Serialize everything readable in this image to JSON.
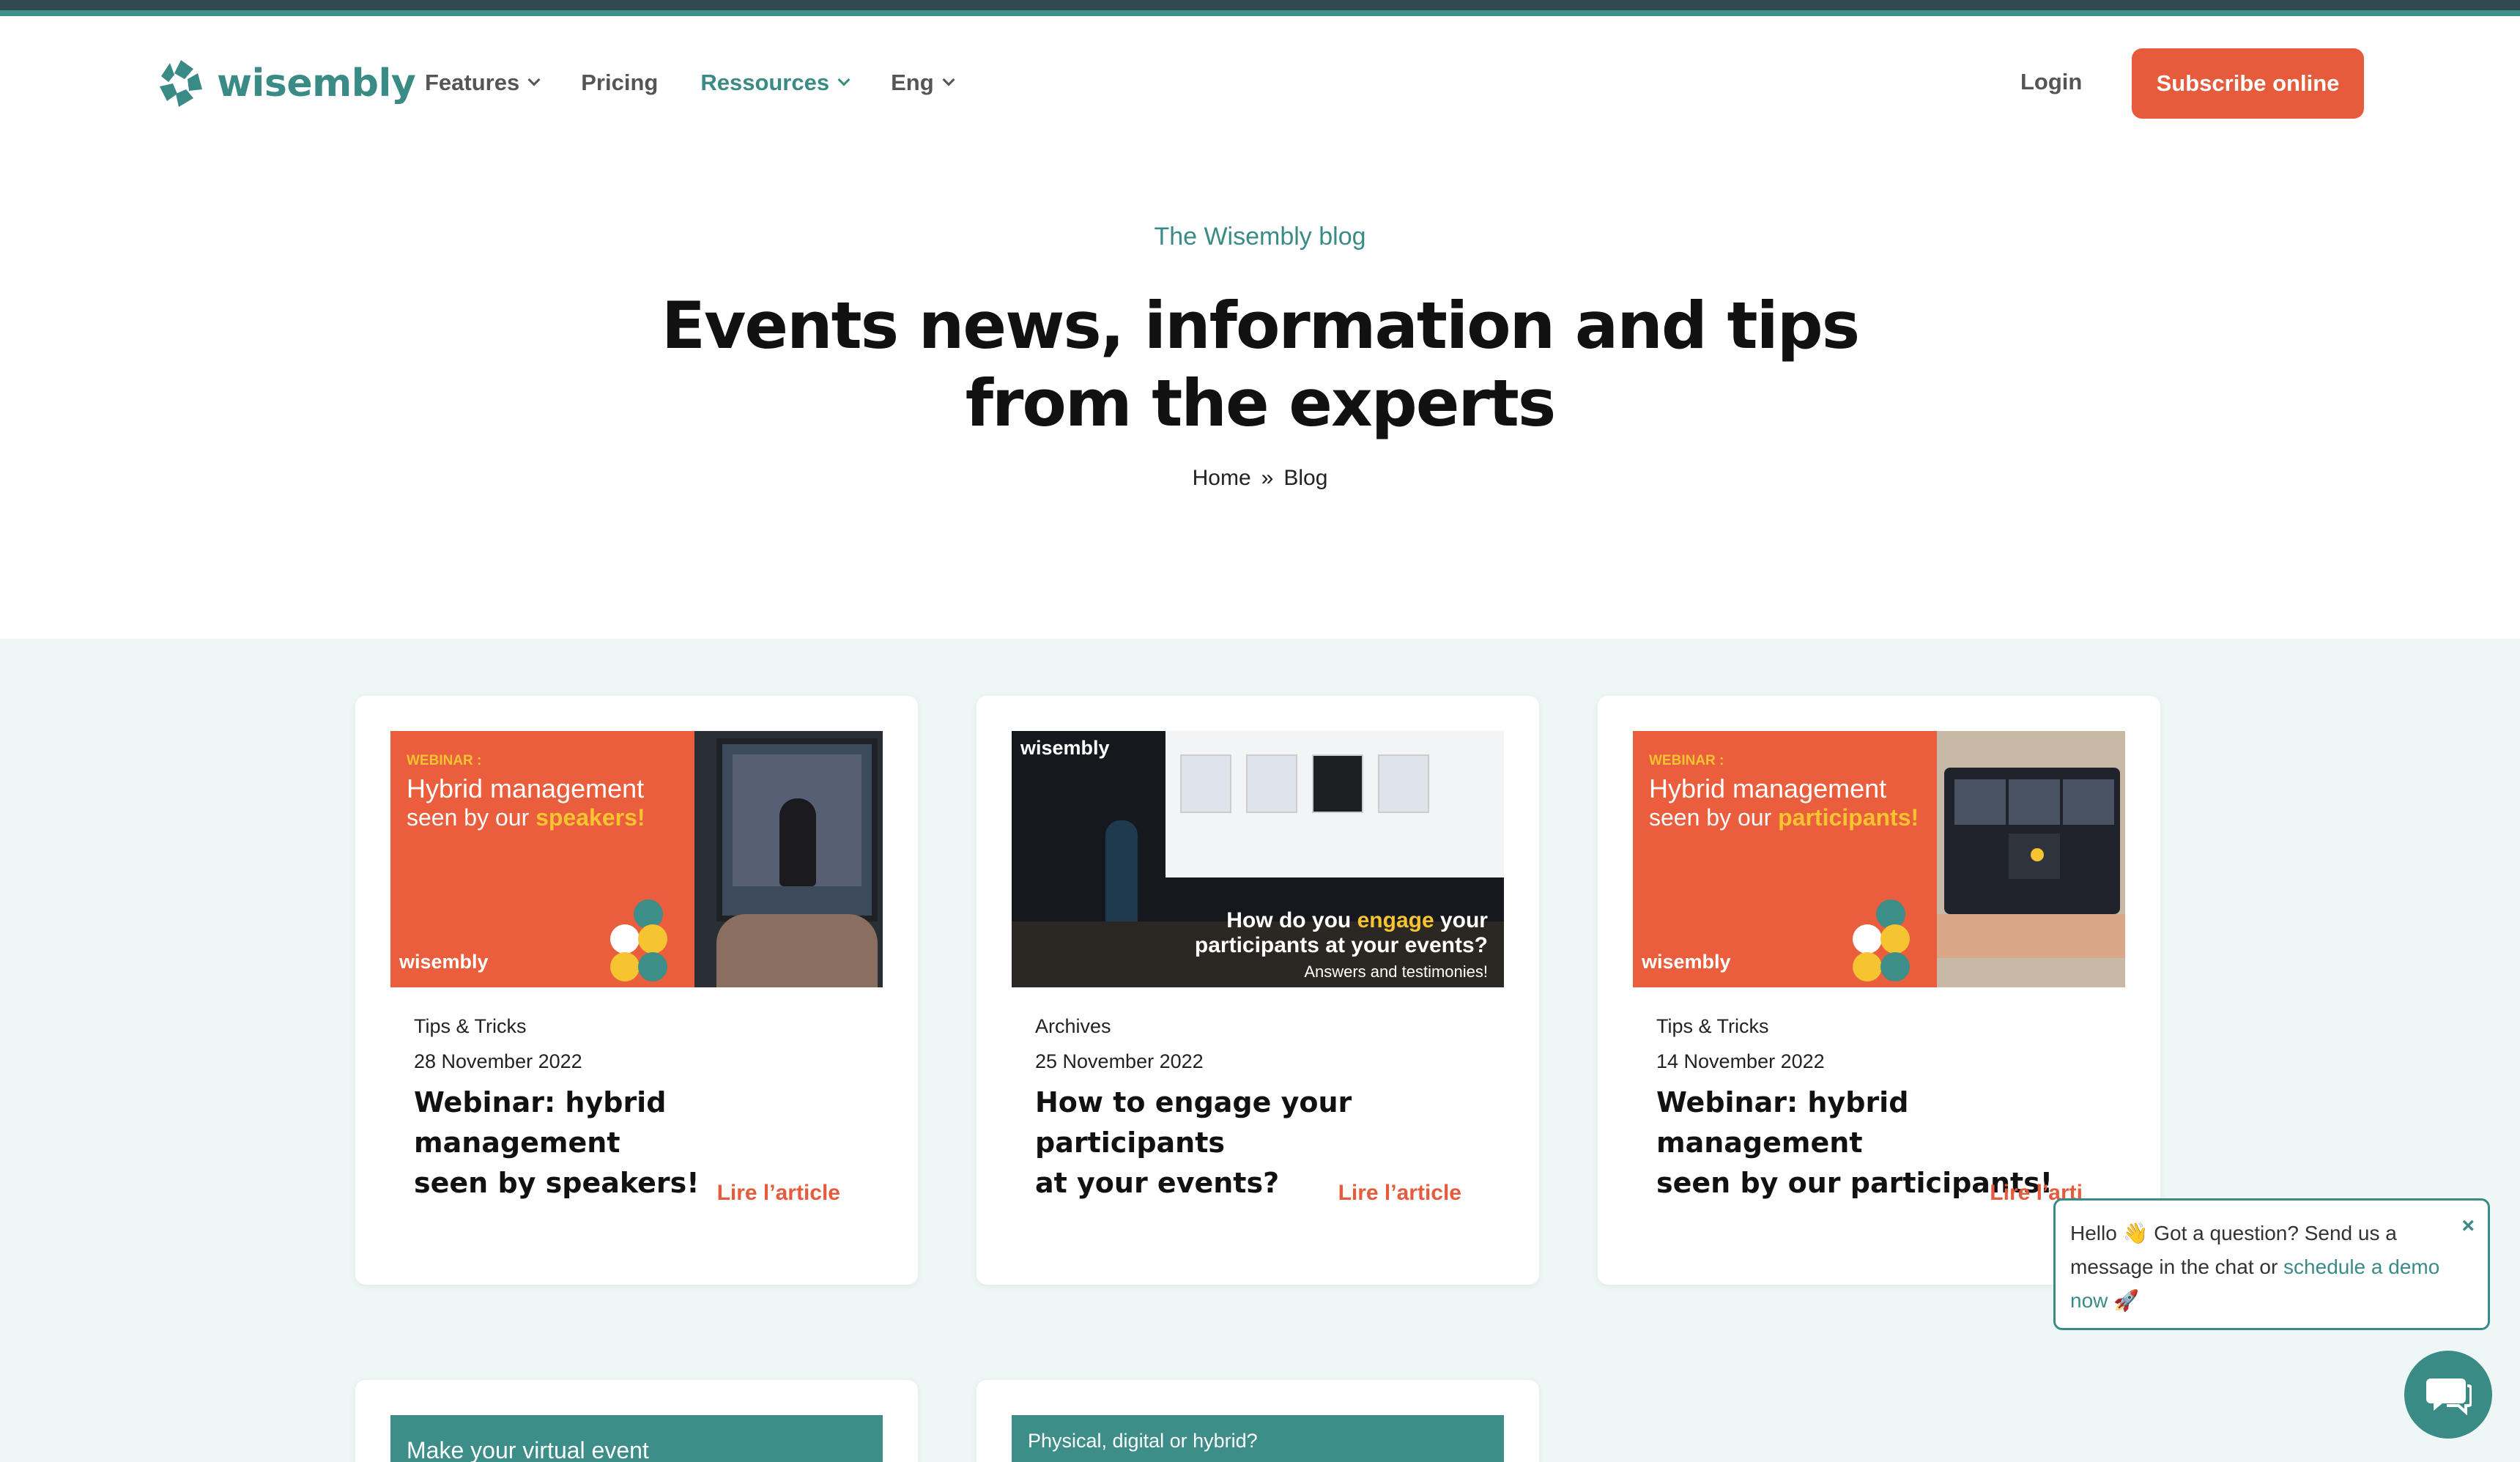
{
  "brand": {
    "name": "wisembly",
    "color": "#3a8b86",
    "accent": "#e55b3c"
  },
  "nav": {
    "items": [
      {
        "label": "Features",
        "has_dropdown": true,
        "active": false
      },
      {
        "label": "Pricing",
        "has_dropdown": false,
        "active": false
      },
      {
        "label": "Ressources",
        "has_dropdown": true,
        "active": true
      },
      {
        "label": "Eng",
        "has_dropdown": true,
        "active": false
      }
    ],
    "login": "Login",
    "subscribe": "Subscribe online"
  },
  "hero": {
    "kicker": "The Wisembly blog",
    "title_line1": "Events news, information and tips",
    "title_line2": "from the experts",
    "breadcrumb": {
      "home": "Home",
      "separator": "»",
      "current": "Blog"
    }
  },
  "posts": [
    {
      "category": "Tips & Tricks",
      "date": "28 November 2022",
      "title_line1": "Webinar: hybrid management",
      "title_line2": "seen by speakers!",
      "cta": "Lire l’article",
      "image": {
        "tag": "WEBINAR :",
        "line1": "Hybrid management",
        "line2": "seen by our ",
        "highlight": "speakers",
        "suffix": "!",
        "brand": "wisembly"
      }
    },
    {
      "category": "Archives",
      "date": "25 November 2022",
      "title_line1": "How to engage your participants",
      "title_line2": "at your events?",
      "cta": "Lire l’article",
      "image": {
        "brand": "wisembly",
        "line1_pre": "How do you ",
        "highlight": "engage",
        "line1_post": " your",
        "line2": "participants at your events?",
        "line3": "Answers and testimonies!"
      }
    },
    {
      "category": "Tips & Tricks",
      "date": "14 November 2022",
      "title_line1": "Webinar: hybrid management",
      "title_line2": "seen by our participants!",
      "cta": "Lire l’arti",
      "image": {
        "tag": "WEBINAR :",
        "line1": "Hybrid management",
        "line2": "seen by our ",
        "highlight": "participants",
        "suffix": "!",
        "brand": "wisembly"
      }
    },
    {
      "image": {
        "line1": "Make your virtual event"
      }
    },
    {
      "image": {
        "line1": "Physical, digital or hybrid?"
      }
    }
  ],
  "chat": {
    "text_pre": "Hello 👋 Got a question? Send us a message in the chat or ",
    "link": "schedule a demo now",
    "text_post": " 🚀",
    "close": "×"
  }
}
